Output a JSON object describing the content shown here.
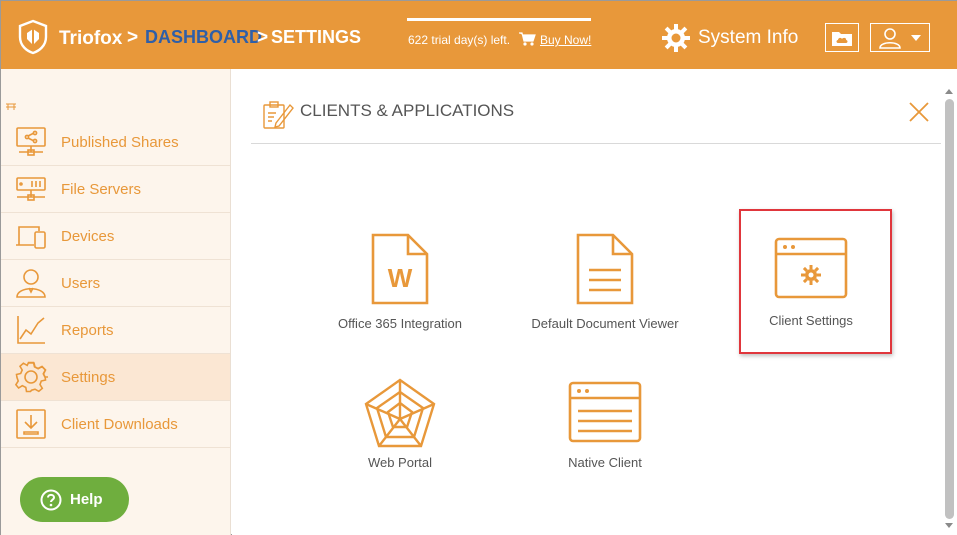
{
  "header": {
    "brand": "Triofox",
    "crumb_sep": ">",
    "crumb_dashboard": "DASHBOARD",
    "crumb_settings": "SETTINGS",
    "trial_text": "622 trial day(s) left.",
    "buy_now": "Buy Now!",
    "system_info": "System Info"
  },
  "sidebar": {
    "items": [
      {
        "label": "Published Shares",
        "icon": "published-shares-icon"
      },
      {
        "label": "File Servers",
        "icon": "file-servers-icon"
      },
      {
        "label": "Devices",
        "icon": "devices-icon"
      },
      {
        "label": "Users",
        "icon": "users-icon"
      },
      {
        "label": "Reports",
        "icon": "reports-icon"
      },
      {
        "label": "Settings",
        "icon": "settings-gear-icon",
        "active": true
      },
      {
        "label": "Client Downloads",
        "icon": "client-downloads-icon"
      }
    ],
    "help_label": "Help"
  },
  "panel": {
    "title": "CLIENTS & APPLICATIONS",
    "apps": [
      {
        "label": "Office 365 Integration",
        "icon": "word-document-icon"
      },
      {
        "label": "Default Document Viewer",
        "icon": "document-viewer-icon"
      },
      {
        "label": "Client Settings",
        "icon": "client-settings-window-icon",
        "highlighted": true
      },
      {
        "label": "Web Portal",
        "icon": "web-portal-icon"
      },
      {
        "label": "Native Client",
        "icon": "native-client-window-icon"
      }
    ]
  },
  "colors": {
    "accent": "#e8983a",
    "crumb_link": "#2f5fa8",
    "help": "#6fae3e",
    "highlight": "#e0363c"
  }
}
